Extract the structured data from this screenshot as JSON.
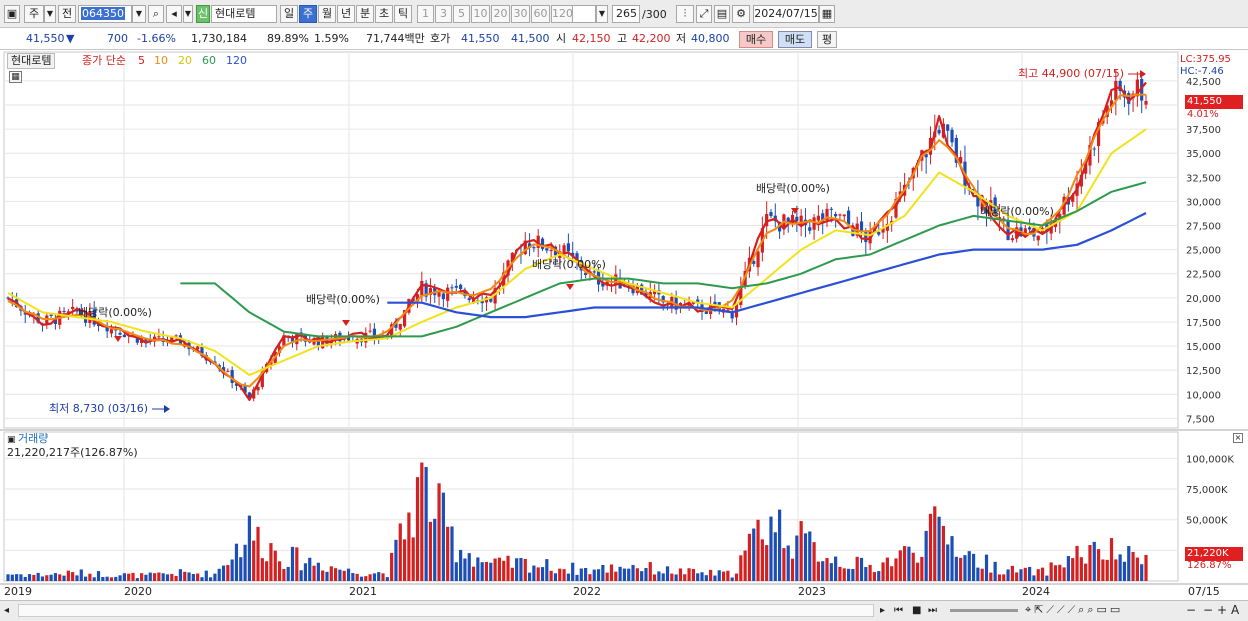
{
  "toolbar": {
    "market_label": "주",
    "prev_label": "전",
    "code": "064350",
    "name_badge": "신",
    "stock_name": "현대로템",
    "periods": [
      "일",
      "주",
      "월",
      "년",
      "분",
      "초",
      "틱"
    ],
    "selected_period": "주",
    "intervals": [
      "1",
      "3",
      "5",
      "10",
      "20",
      "30",
      "60",
      "120"
    ],
    "count": "265",
    "count_total": "/300",
    "date": "2024/07/15"
  },
  "quote": {
    "price": "41,550",
    "change_arrow": "▼",
    "change": "700",
    "change_pct": "-1.66%",
    "volume": "1,730,184",
    "vol_ratio": "89.89%",
    "turnover": "1.59%",
    "amount": "71,744백만",
    "ask_label": "호가",
    "ask": "41,550",
    "bid": "41,500",
    "open_label": "시",
    "open": "42,150",
    "high_label": "고",
    "high": "42,200",
    "low_label": "저",
    "low": "40,800",
    "buy_label": "매수",
    "sell_label": "매도",
    "eval_label": "평"
  },
  "price_panel": {
    "name_tag": "현대로템",
    "ma_label": "종가 단순",
    "ma_periods": [
      "5",
      "10",
      "20",
      "60",
      "120"
    ],
    "lc": "LC:375.95",
    "hc": "HC:-7.46",
    "current_price_tag": "41,550",
    "current_pct_tag": "4.01%",
    "high_marker": "최고 44,900 (07/15)",
    "low_marker": "최저 8,730 (03/16)",
    "dividend_label": "배당락(0.00%)"
  },
  "volume_panel": {
    "title": "거래량",
    "value": "21,220,217주(126.87%)",
    "current_tag": "21,220K",
    "current_pct_tag": "126.87%"
  },
  "x_axis": {
    "labels": [
      "2019",
      "2020",
      "2021",
      "2022",
      "2023",
      "2024"
    ],
    "right_label": "07/15"
  },
  "colors": {
    "up": "#d42020",
    "down": "#1c4fb5",
    "ma5": "#d42020",
    "ma10": "#f08a10",
    "ma20": "#f2e21a",
    "ma60": "#2e9a4e",
    "ma120": "#2b4fd6"
  },
  "chart_data": {
    "type": "line",
    "title": "",
    "x": [
      "2019-01",
      "2019-03",
      "2019-05",
      "2019-07",
      "2019-09",
      "2019-11",
      "2020-01",
      "2020-03",
      "2020-05",
      "2020-07",
      "2020-09",
      "2020-11",
      "2021-01",
      "2021-03",
      "2021-05",
      "2021-07",
      "2021-09",
      "2021-11",
      "2022-01",
      "2022-03",
      "2022-05",
      "2022-07",
      "2022-09",
      "2022-11",
      "2023-01",
      "2023-03",
      "2023-05",
      "2023-07",
      "2023-09",
      "2023-11",
      "2024-01",
      "2024-03",
      "2024-05",
      "2024-07"
    ],
    "series": [
      {
        "name": "종가",
        "values": [
          20000,
          17500,
          18500,
          17000,
          15500,
          15500,
          13500,
          9500,
          16000,
          15500,
          16000,
          16000,
          21000,
          20500,
          20000,
          26000,
          25000,
          22000,
          21500,
          19500,
          19000,
          18500,
          28000,
          27500,
          28500,
          26000,
          31000,
          38000,
          31000,
          27000,
          26500,
          32000,
          41000,
          41550
        ]
      },
      {
        "name": "20",
        "values": [
          20500,
          18500,
          18000,
          17500,
          16500,
          15800,
          14500,
          12000,
          13500,
          15000,
          15500,
          15800,
          17500,
          19000,
          20000,
          23000,
          24500,
          23000,
          21500,
          20500,
          19500,
          19000,
          22000,
          25000,
          27000,
          26500,
          28500,
          33000,
          31000,
          28500,
          27000,
          29000,
          35000,
          37500
        ]
      },
      {
        "name": "60",
        "values": [
          null,
          null,
          null,
          null,
          null,
          null,
          21500,
          18500,
          16500,
          16000,
          16000,
          16000,
          16000,
          17000,
          18500,
          20000,
          21500,
          22000,
          22000,
          21500,
          21500,
          21000,
          21500,
          22500,
          24000,
          24500,
          26000,
          27500,
          28500,
          28000,
          27500,
          29000,
          31000,
          32000
        ]
      },
      {
        "name": "120",
        "values": [
          null,
          null,
          null,
          null,
          null,
          null,
          null,
          null,
          null,
          null,
          null,
          null,
          19500,
          18500,
          18000,
          18000,
          18500,
          19000,
          19000,
          19000,
          19000,
          18500,
          19500,
          20500,
          21500,
          22500,
          23500,
          24500,
          25000,
          25000,
          25000,
          25500,
          27000,
          28800
        ]
      }
    ],
    "volume_k": [
      8000,
      7000,
      9000,
      7500,
      6000,
      9000,
      8000,
      55000,
      28000,
      20000,
      10000,
      9000,
      110000,
      40000,
      18000,
      20000,
      15000,
      12000,
      18000,
      12000,
      9000,
      8000,
      70000,
      45000,
      25000,
      15000,
      30000,
      60000,
      25000,
      12000,
      10000,
      30000,
      32000,
      21220
    ],
    "y_ticks": [
      "42,500",
      "40,000",
      "37,500",
      "35,000",
      "32,500",
      "30,000",
      "27,500",
      "25,000",
      "22,500",
      "20,000",
      "17,500",
      "15,000",
      "12,500",
      "10,000",
      "7,500"
    ],
    "vol_ticks": [
      "100,000K",
      "75,000K",
      "50,000K",
      "25,000K"
    ],
    "ylim": [
      6500,
      45500
    ],
    "grid": true,
    "legend": "top-left"
  }
}
